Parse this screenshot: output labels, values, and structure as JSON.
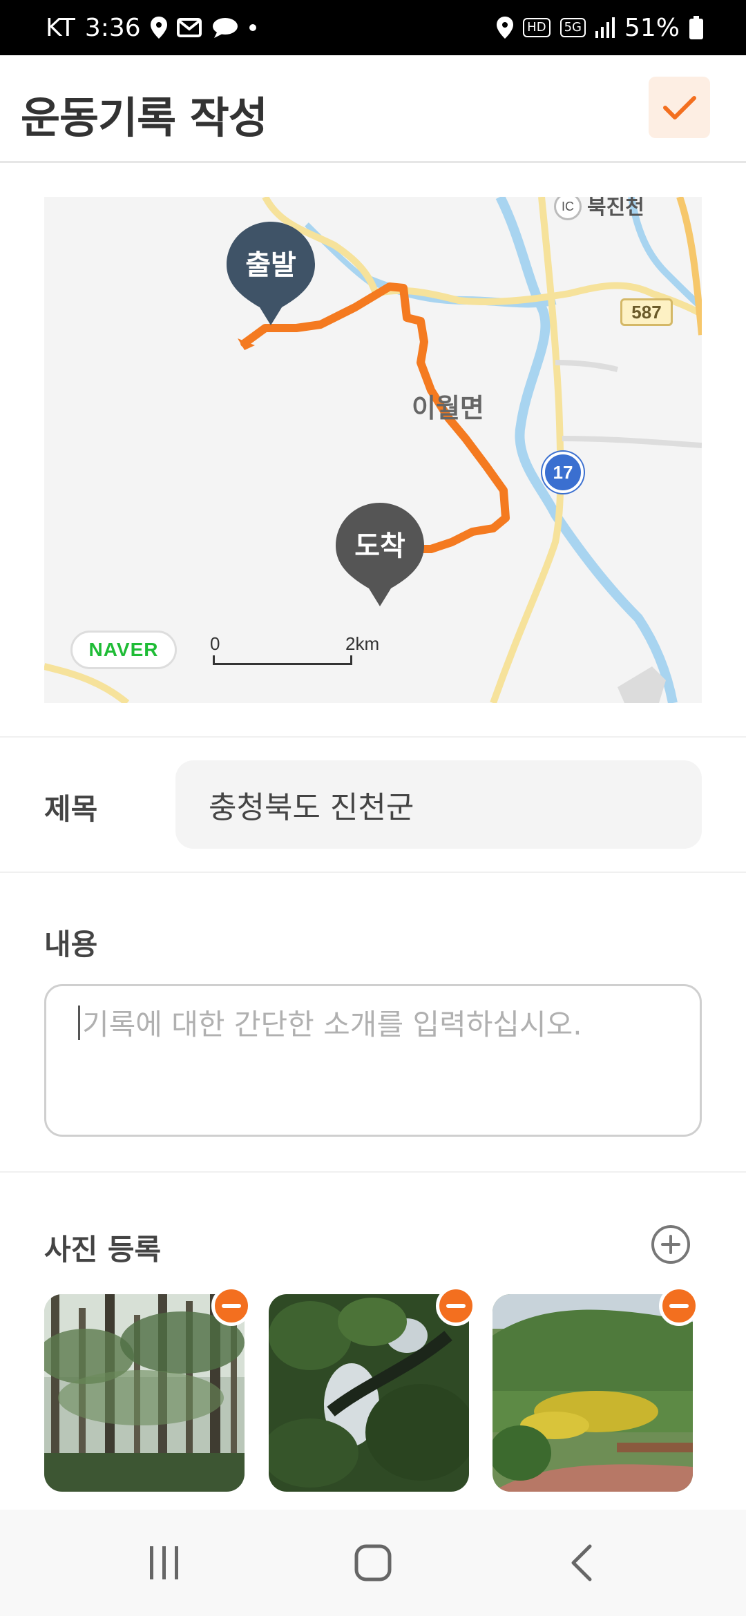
{
  "status_bar": {
    "carrier": "KT",
    "time": "3:36",
    "network_badge_hd": "HD",
    "network_badge_5g": "5G",
    "battery": "51%"
  },
  "header": {
    "title": "운동기록 작성",
    "confirm_icon": "checkmark-icon"
  },
  "map": {
    "start_label": "출발",
    "end_label": "도착",
    "place_label": "이월면",
    "top_label": "북진천",
    "ic_label": "IC",
    "road_number": "587",
    "route_number": "17",
    "logo": "NAVER",
    "scale_start": "0",
    "scale_end": "2km",
    "route_color": "#f47a20"
  },
  "form": {
    "title_label": "제목",
    "title_value": "충청북도 진천군",
    "content_label": "내용",
    "content_placeholder": "기록에 대한 간단한 소개를 입력하십시오.",
    "photos_label": "사진 등록",
    "photos": [
      {
        "name": "forest-photo"
      },
      {
        "name": "tree-canopy-photo"
      },
      {
        "name": "park-photo"
      }
    ]
  },
  "colors": {
    "accent": "#f36f1f",
    "accent_bg": "#fdeee3"
  }
}
